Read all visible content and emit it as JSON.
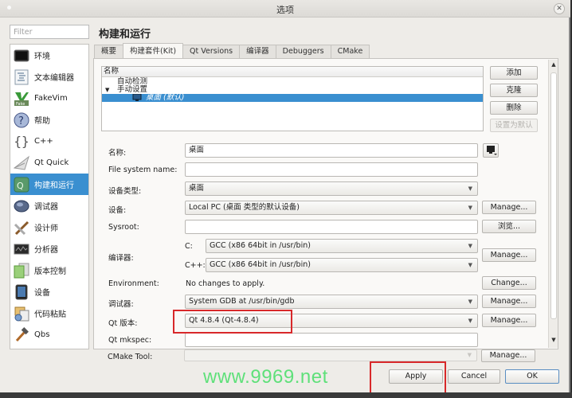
{
  "window": {
    "title": "选项",
    "close_icon": "close-icon"
  },
  "filter": {
    "placeholder": "Filter",
    "value": ""
  },
  "sidebar": {
    "items": [
      {
        "label": "环境",
        "icon": "monitor-icon"
      },
      {
        "label": "文本编辑器",
        "icon": "text-editor-icon"
      },
      {
        "label": "FakeVim",
        "icon": "fakevim-icon"
      },
      {
        "label": "帮助",
        "icon": "help-icon"
      },
      {
        "label": "C++",
        "icon": "braces-icon"
      },
      {
        "label": "Qt Quick",
        "icon": "paper-plane-icon"
      },
      {
        "label": "构建和运行",
        "icon": "qt-build-icon",
        "selected": true
      },
      {
        "label": "调试器",
        "icon": "bug-icon"
      },
      {
        "label": "设计师",
        "icon": "designer-icon"
      },
      {
        "label": "分析器",
        "icon": "analyzer-icon"
      },
      {
        "label": "版本控制",
        "icon": "version-control-icon"
      },
      {
        "label": "设备",
        "icon": "device-icon"
      },
      {
        "label": "代码粘贴",
        "icon": "code-paste-icon"
      },
      {
        "label": "Qbs",
        "icon": "hammer-icon"
      }
    ]
  },
  "page": {
    "title": "构建和运行"
  },
  "tabs": [
    {
      "label": "概要"
    },
    {
      "label": "构建套件(Kit)",
      "active": true
    },
    {
      "label": "Qt Versions"
    },
    {
      "label": "编译器"
    },
    {
      "label": "Debuggers"
    },
    {
      "label": "CMake"
    }
  ],
  "kit_tree": {
    "header": "名称",
    "rows": [
      {
        "label": "自动检测"
      },
      {
        "label": "手动设置",
        "expanded": true
      },
      {
        "label": "桌面 (默认)",
        "selected": true,
        "icon": "monitor-icon"
      }
    ]
  },
  "kit_buttons": {
    "add": "添加",
    "clone": "克隆",
    "remove": "删除",
    "make_default": "设置为默认"
  },
  "form": {
    "name_label": "名称:",
    "name_value": "桌面",
    "fs_name_label": "File system name:",
    "fs_name_value": "",
    "device_type_label": "设备类型:",
    "device_type_value": "桌面",
    "device_label": "设备:",
    "device_value": "Local PC (桌面 类型的默认设备)",
    "device_manage": "Manage...",
    "sysroot_label": "Sysroot:",
    "sysroot_value": "",
    "sysroot_browse": "浏览...",
    "compiler_label": "编译器:",
    "compiler_c_label": "C:",
    "compiler_c_value": "GCC (x86 64bit in /usr/bin)",
    "compiler_cpp_label": "C++:",
    "compiler_cpp_value": "GCC (x86 64bit in /usr/bin)",
    "compiler_manage": "Manage...",
    "env_label": "Environment:",
    "env_value": "No changes to apply.",
    "env_change": "Change...",
    "debugger_label": "调试器:",
    "debugger_value": "System GDB at /usr/bin/gdb",
    "debugger_manage": "Manage...",
    "qt_version_label": "Qt 版本:",
    "qt_version_value": "Qt 4.8.4 (Qt-4.8.4)",
    "qt_version_manage": "Manage...",
    "mkspec_label": "Qt mkspec:",
    "mkspec_value": "",
    "cmake_label": "CMake Tool:",
    "cmake_value": "",
    "cmake_manage": "Manage..."
  },
  "footer": {
    "apply": "Apply",
    "cancel": "Cancel",
    "ok": "OK"
  },
  "watermark": "www.9969.net",
  "colors": {
    "selection": "#3a8fd0",
    "highlight_box": "#d8282a",
    "watermark": "#5fe07a"
  }
}
